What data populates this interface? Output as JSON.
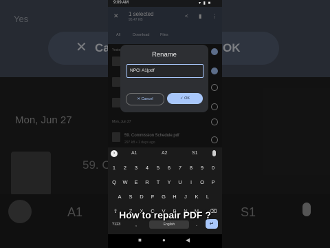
{
  "background": {
    "yesterday_label": "Yes",
    "date_label": "Mon, Jun 27",
    "cancel_partial": "Ca",
    "ok_label": "OK",
    "file_partial": "59. Con          pdf",
    "suggestion_a1": "A1",
    "suggestion_s1": "S1"
  },
  "status_bar": {
    "time": "9:09 AM",
    "right": "▾ ▮ ■"
  },
  "app_bar": {
    "title": "1 selected",
    "subtitle": "95.47 KB"
  },
  "tabs": [
    "All",
    "Download",
    "Files"
  ],
  "list": {
    "headers": [
      "Yesterday",
      "Mon, Jun 27"
    ],
    "rows": [
      {
        "name": "59. Commission Schedule.pdf",
        "meta": "297 kB • 1 days ago"
      }
    ]
  },
  "dialog": {
    "title": "Rename",
    "input_value": "NPCI A1|pdf",
    "cancel_label": "Cancel",
    "ok_label": "OK"
  },
  "keyboard": {
    "suggestions": [
      "A1",
      "A2",
      "S1"
    ],
    "row_numbers": [
      "1",
      "2",
      "3",
      "4",
      "5",
      "6",
      "7",
      "8",
      "9",
      "0"
    ],
    "row_q": [
      "Q",
      "W",
      "E",
      "R",
      "T",
      "Y",
      "U",
      "I",
      "O",
      "P"
    ],
    "row_a": [
      "A",
      "S",
      "D",
      "F",
      "G",
      "H",
      "J",
      "K",
      "L"
    ],
    "row_z": [
      "⇧",
      "Z",
      "X",
      "C",
      "V",
      "B",
      "N",
      "M",
      "⌫"
    ],
    "key_123": "?123",
    "key_comma": ",",
    "space_label": "English",
    "key_dot": ".",
    "enter_symbol": "↵"
  },
  "nav_bar": {
    "recent": "■",
    "home": "●",
    "back": "◀"
  },
  "caption": "How to repair PDF ?"
}
